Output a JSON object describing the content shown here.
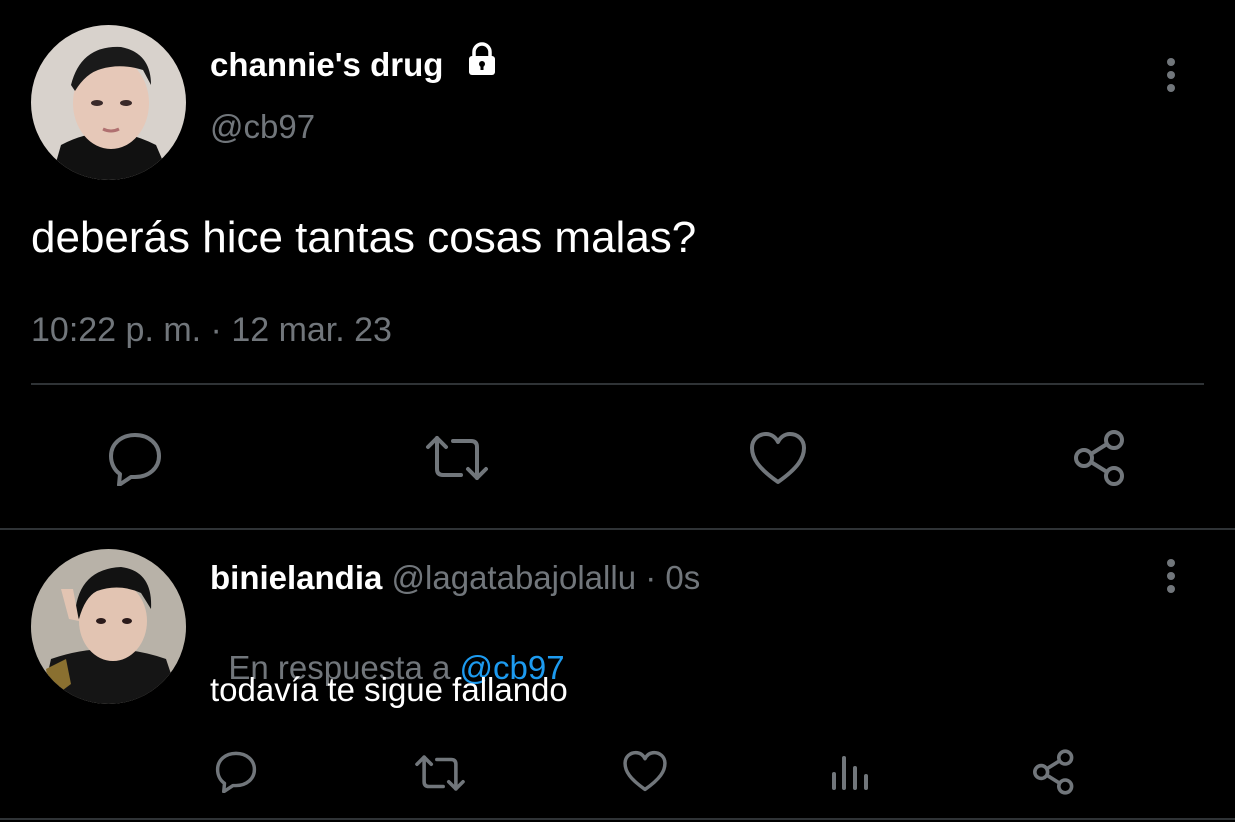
{
  "main_tweet": {
    "display_name": "channie's drug",
    "handle": "@cb97",
    "text": "deberás hice tantas cosas malas?",
    "timestamp": "10:22 p. m. · 12 mar. 23",
    "protected_icon": "lock-icon"
  },
  "reply": {
    "display_name": "binielandia",
    "handle": "@lagatabajolallu",
    "separator": " · ",
    "time_ago": "0s",
    "replying_prefix": "En respuesta a ",
    "replying_to": "@cb97",
    "text": "todavía te sigue fallando"
  },
  "icons": {
    "more": "more-vertical-icon",
    "reply": "reply-icon",
    "retweet": "retweet-icon",
    "like": "like-icon",
    "views": "views-icon",
    "share": "share-icon"
  },
  "colors": {
    "background": "#000000",
    "text": "#e7e9ea",
    "secondary": "#71767b",
    "link": "#1d9bf0",
    "divider": "#2f3336"
  }
}
